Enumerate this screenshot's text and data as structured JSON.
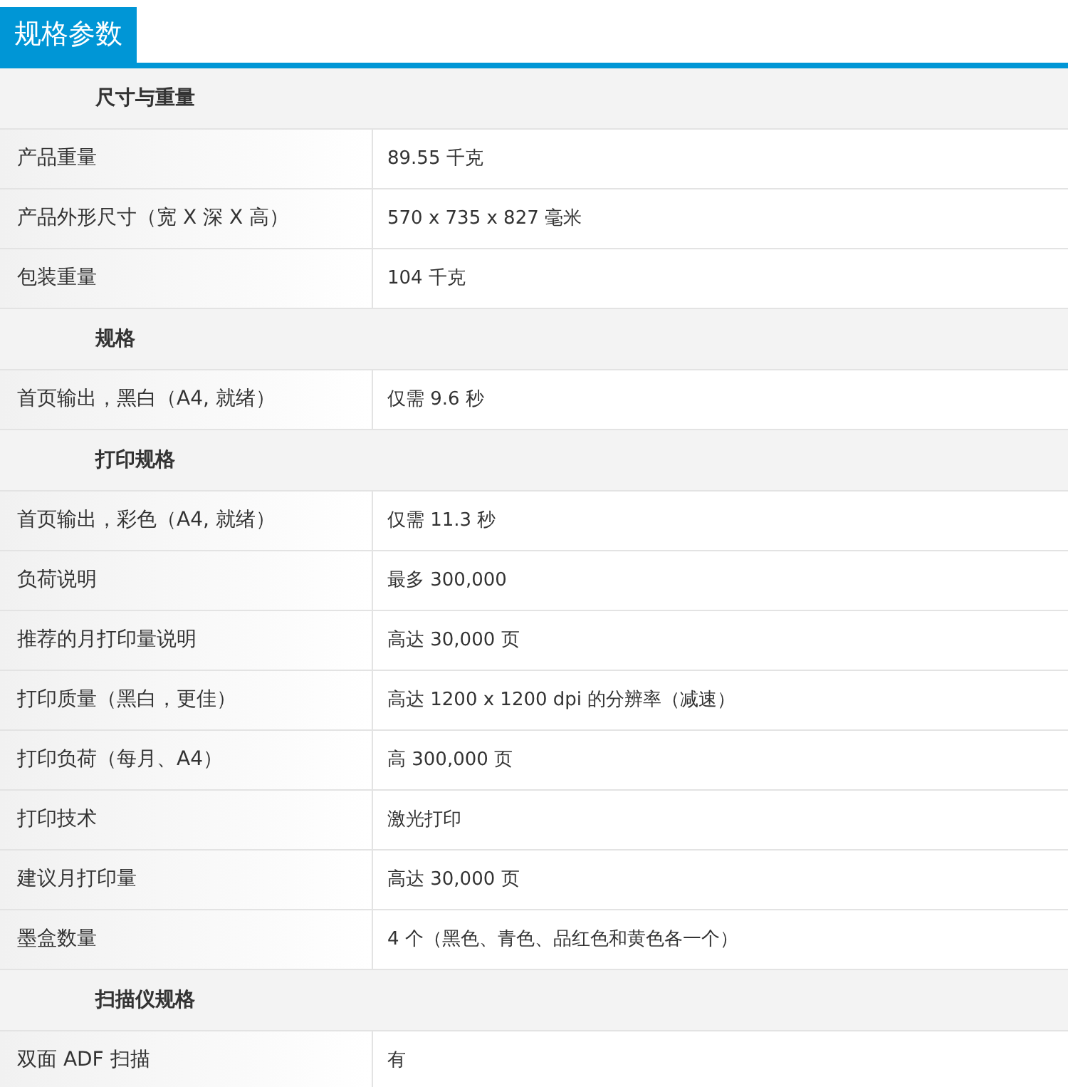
{
  "tab": {
    "label": "规格参数",
    "selected": true
  },
  "sections": [
    {
      "title": "尺寸与重量",
      "rows": [
        {
          "label": "产品重量",
          "value": "89.55 千克"
        },
        {
          "label": "产品外形尺寸（宽 X 深 X 高）",
          "value": "570 x 735 x 827 毫米"
        },
        {
          "label": "包装重量",
          "value": "104 千克"
        }
      ]
    },
    {
      "title": "规格",
      "rows": [
        {
          "label": "首页输出，黑白（A4, 就绪）",
          "value": "仅需 9.6 秒"
        }
      ]
    },
    {
      "title": "打印规格",
      "rows": [
        {
          "label": "首页输出，彩色（A4, 就绪）",
          "value": "仅需 11.3 秒"
        },
        {
          "label": "负荷说明",
          "value": "最多 300,000"
        },
        {
          "label": "推荐的月打印量说明",
          "value": "高达 30,000 页"
        },
        {
          "label": "打印质量（黑白，更佳）",
          "value": "高达 1200 x 1200 dpi 的分辨率（减速）"
        },
        {
          "label": "打印负荷（每月、A4）",
          "value": "高 300,000 页"
        },
        {
          "label": "打印技术",
          "value": "激光打印"
        },
        {
          "label": "建议月打印量",
          "value": "高达 30,000 页"
        },
        {
          "label": "墨盒数量",
          "value": "4 个（黑色、青色、品红色和黄色各一个）"
        }
      ]
    },
    {
      "title": "扫描仪规格",
      "rows": [
        {
          "label": "双面 ADF 扫描",
          "value": "有"
        }
      ]
    }
  ]
}
